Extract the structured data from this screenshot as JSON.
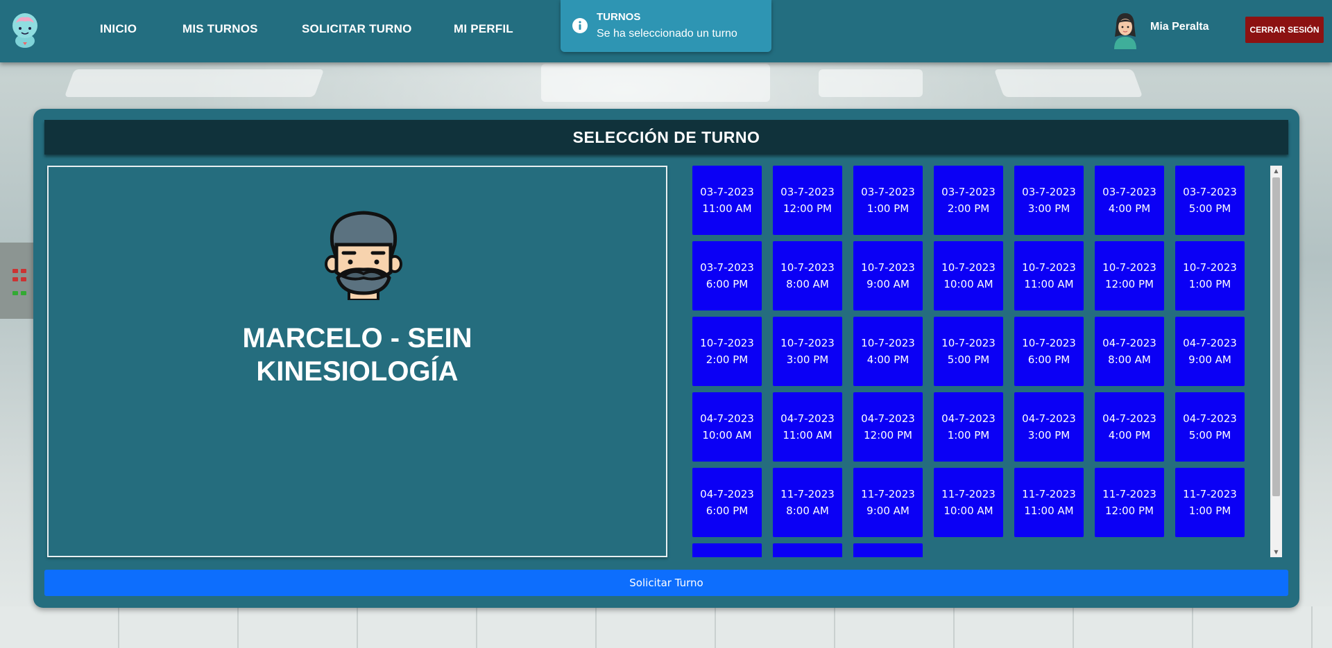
{
  "nav": {
    "items": [
      {
        "label": "INICIO"
      },
      {
        "label": "MIS TURNOS"
      },
      {
        "label": "SOLICITAR TURNO"
      },
      {
        "label": "MI PERFIL"
      }
    ],
    "user_name": "Mia Peralta",
    "logout_label": "CERRAR SESIÓN"
  },
  "toast": {
    "title": "TURNOS",
    "message": "Se ha seleccionado un turno"
  },
  "panel": {
    "title": "SELECCIÓN DE TURNO",
    "doctor_name": "MARCELO - SEIN",
    "specialty": "KINESIOLOGÍA",
    "request_label": "Solicitar Turno"
  },
  "slots": [
    {
      "date": "03-7-2023",
      "time": "11:00 AM"
    },
    {
      "date": "03-7-2023",
      "time": "12:00 PM"
    },
    {
      "date": "03-7-2023",
      "time": "1:00 PM"
    },
    {
      "date": "03-7-2023",
      "time": "2:00 PM"
    },
    {
      "date": "03-7-2023",
      "time": "3:00 PM"
    },
    {
      "date": "03-7-2023",
      "time": "4:00 PM"
    },
    {
      "date": "03-7-2023",
      "time": "5:00 PM"
    },
    {
      "date": "03-7-2023",
      "time": "6:00 PM"
    },
    {
      "date": "10-7-2023",
      "time": "8:00 AM"
    },
    {
      "date": "10-7-2023",
      "time": "9:00 AM"
    },
    {
      "date": "10-7-2023",
      "time": "10:00 AM"
    },
    {
      "date": "10-7-2023",
      "time": "11:00 AM"
    },
    {
      "date": "10-7-2023",
      "time": "12:00 PM"
    },
    {
      "date": "10-7-2023",
      "time": "1:00 PM"
    },
    {
      "date": "10-7-2023",
      "time": "2:00 PM"
    },
    {
      "date": "10-7-2023",
      "time": "3:00 PM"
    },
    {
      "date": "10-7-2023",
      "time": "4:00 PM"
    },
    {
      "date": "10-7-2023",
      "time": "5:00 PM"
    },
    {
      "date": "10-7-2023",
      "time": "6:00 PM"
    },
    {
      "date": "04-7-2023",
      "time": "8:00 AM"
    },
    {
      "date": "04-7-2023",
      "time": "9:00 AM"
    },
    {
      "date": "04-7-2023",
      "time": "10:00 AM"
    },
    {
      "date": "04-7-2023",
      "time": "11:00 AM"
    },
    {
      "date": "04-7-2023",
      "time": "12:00 PM"
    },
    {
      "date": "04-7-2023",
      "time": "1:00 PM"
    },
    {
      "date": "04-7-2023",
      "time": "3:00 PM"
    },
    {
      "date": "04-7-2023",
      "time": "4:00 PM"
    },
    {
      "date": "04-7-2023",
      "time": "5:00 PM"
    },
    {
      "date": "04-7-2023",
      "time": "6:00 PM"
    },
    {
      "date": "11-7-2023",
      "time": "8:00 AM"
    },
    {
      "date": "11-7-2023",
      "time": "9:00 AM"
    },
    {
      "date": "11-7-2023",
      "time": "10:00 AM"
    },
    {
      "date": "11-7-2023",
      "time": "11:00 AM"
    },
    {
      "date": "11-7-2023",
      "time": "12:00 PM"
    },
    {
      "date": "11-7-2023",
      "time": "1:00 PM"
    },
    {
      "date": "",
      "time": ""
    },
    {
      "date": "",
      "time": ""
    },
    {
      "date": "",
      "time": ""
    }
  ],
  "colors": {
    "navbar": "#236e80",
    "panel": "#256d7e",
    "title_bar": "#10323b",
    "slot": "#0b00f5",
    "toast": "#2e95b3",
    "logout": "#8c1212",
    "request_button": "#0d6efd"
  },
  "icons": {
    "logo": "brain-mascot-icon",
    "toast": "info-circle-icon",
    "user": "user-avatar-icon",
    "doctor": "doctor-avatar-icon"
  }
}
